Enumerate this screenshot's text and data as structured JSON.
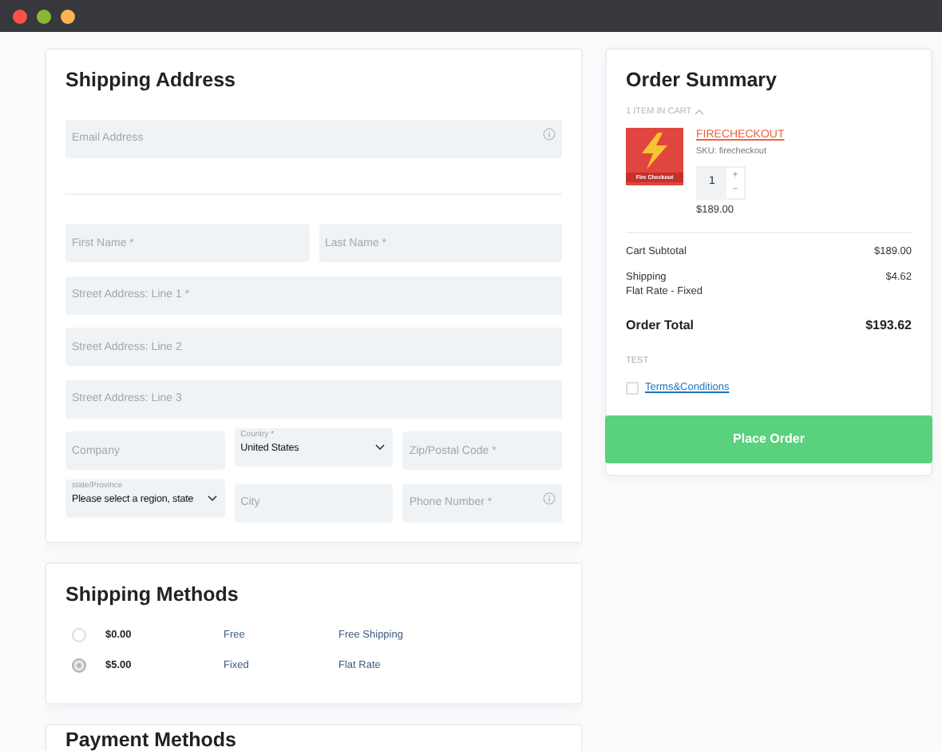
{
  "window": {
    "controls": [
      {
        "color": "#fe4f4b"
      },
      {
        "color": "#8bb834"
      },
      {
        "color": "#fdb455"
      }
    ]
  },
  "shipping_address": {
    "title": "Shipping Address",
    "email": {
      "placeholder": "Email Address",
      "info": true
    },
    "rows": [
      [
        {
          "kind": "input",
          "placeholder": "First Name *"
        },
        {
          "kind": "input",
          "placeholder": "Last Name *"
        }
      ],
      [
        {
          "kind": "input",
          "placeholder": "Street Address: Line 1 *"
        }
      ],
      [
        {
          "kind": "input",
          "placeholder": "Street Address: Line 2"
        }
      ],
      [
        {
          "kind": "input",
          "placeholder": "Street Address: Line 3"
        }
      ],
      [
        {
          "kind": "input",
          "placeholder": "Company"
        },
        {
          "kind": "select",
          "label": "Country *",
          "value": "United States"
        },
        {
          "kind": "input",
          "placeholder": "Zip/Postal Code *"
        }
      ],
      [
        {
          "kind": "select",
          "label": "state/Province",
          "value": "Please select a region, state"
        },
        {
          "kind": "input",
          "placeholder": "City"
        },
        {
          "kind": "input",
          "placeholder": "Phone Number *",
          "info": true
        }
      ]
    ]
  },
  "shipping_methods": {
    "title": "Shipping Methods",
    "options": [
      {
        "price": "$0.00",
        "code": "Free",
        "name": "Free Shipping",
        "selected": false
      },
      {
        "price": "$5.00",
        "code": "Fixed",
        "name": "Flat Rate",
        "selected": true
      }
    ]
  },
  "payment_methods": {
    "title": "Payment Methods"
  },
  "order_summary": {
    "title": "Order Summary",
    "cart_count": "1 ITEM IN CART",
    "items": [
      {
        "name": "FIRECHECKOUT",
        "sku": "SKU: firecheckout",
        "image_caption": "Fire Checkout",
        "qty": "1",
        "plus": "+",
        "minus": "−",
        "price": "$189.00"
      }
    ],
    "totals": [
      {
        "label": "Cart Subtotal",
        "value": "$189.00"
      },
      {
        "label": "Shipping",
        "detail": "Flat Rate - Fixed",
        "value": "$4.62"
      }
    ],
    "grand_total": {
      "label": "Order Total",
      "value": "$193.62"
    },
    "note": "TEST",
    "terms": {
      "label": "Terms&Conditions",
      "checked": false
    },
    "button": "Place Order"
  }
}
